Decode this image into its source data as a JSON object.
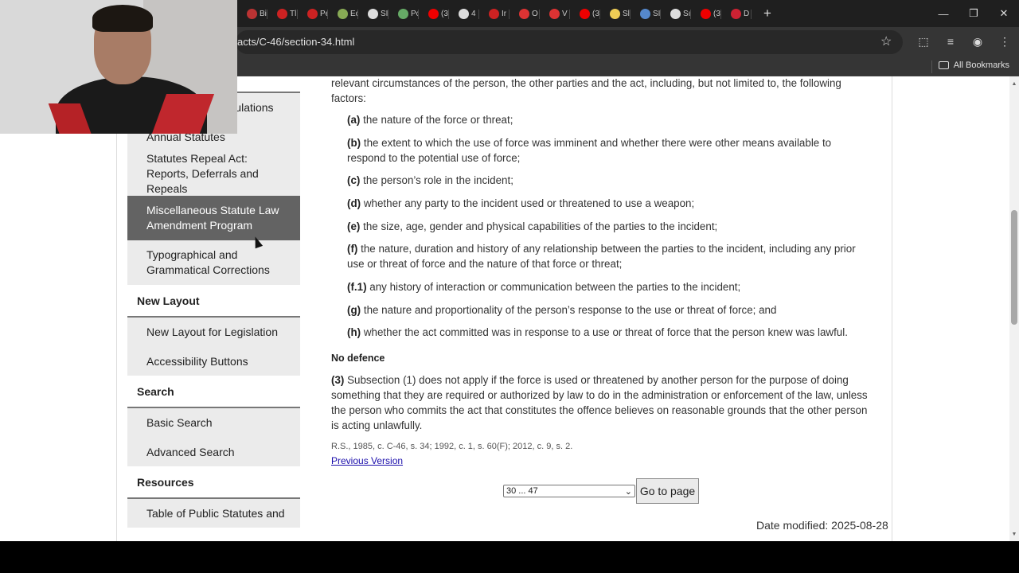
{
  "browser": {
    "tabs": [
      {
        "label": "Bi",
        "color": "#b33"
      },
      {
        "label": "Tl",
        "color": "#c22"
      },
      {
        "label": "Pe",
        "color": "#c22"
      },
      {
        "label": "Ec",
        "color": "#8a5"
      },
      {
        "label": "SI",
        "color": "#ddd"
      },
      {
        "label": "Pc",
        "color": "#6a6"
      },
      {
        "label": "(3",
        "color": "#e00"
      },
      {
        "label": "4",
        "color": "#ddd"
      },
      {
        "label": "Ir",
        "color": "#c22"
      },
      {
        "label": "O",
        "color": "#d33"
      },
      {
        "label": "V",
        "color": "#d33"
      },
      {
        "label": "(3",
        "color": "#e00"
      },
      {
        "label": "Sl",
        "color": "#ec5"
      },
      {
        "label": "SI",
        "color": "#58c"
      },
      {
        "label": "Sı",
        "color": "#ddd"
      },
      {
        "label": "(3",
        "color": "#e00"
      },
      {
        "label": "D",
        "color": "#c23"
      }
    ],
    "url": "acts/C-46/section-34.html",
    "all_bookmarks": "All Bookmarks"
  },
  "sidebar": {
    "items": [
      {
        "label": "Consolidated Regulations",
        "type": "item"
      },
      {
        "label": "Annual Statutes",
        "type": "item"
      },
      {
        "label": "Statutes Repeal Act: Reports, Deferrals and Repeals",
        "type": "item"
      },
      {
        "label": "Miscellaneous Statute Law Amendment Program",
        "type": "item",
        "active": true
      },
      {
        "label": "Typographical and Grammatical Corrections",
        "type": "item"
      },
      {
        "label": "New Layout",
        "type": "heading"
      },
      {
        "label": "New Layout for Legislation",
        "type": "item"
      },
      {
        "label": "Accessibility Buttons",
        "type": "item"
      },
      {
        "label": "Search",
        "type": "heading"
      },
      {
        "label": "Basic Search",
        "type": "item"
      },
      {
        "label": "Advanced Search",
        "type": "item"
      },
      {
        "label": "Resources",
        "type": "heading"
      },
      {
        "label": "Table of Public Statutes and",
        "type": "item"
      }
    ]
  },
  "content": {
    "intro": "relevant circumstances of the person, the other parties and the act, including, but not limited to, the following factors:",
    "factors": [
      {
        "marker": "(a)",
        "text": "the nature of the force or threat;"
      },
      {
        "marker": "(b)",
        "text": "the extent to which the use of force was imminent and whether there were other means available to respond to the potential use of force;"
      },
      {
        "marker": "(c)",
        "text": "the person’s role in the incident;"
      },
      {
        "marker": "(d)",
        "text": "whether any party to the incident used or threatened to use a weapon;"
      },
      {
        "marker": "(e)",
        "text": "the size, age, gender and physical capabilities of the parties to the incident;"
      },
      {
        "marker": "(f)",
        "text": "the nature, duration and history of any relationship between the parties to the incident, including any prior use or threat of force and the nature of that force or threat;"
      },
      {
        "marker": "(f.1)",
        "text": "any history of interaction or communication between the parties to the incident;"
      },
      {
        "marker": "(g)",
        "text": "the nature and proportionality of the person’s response to the use or threat of force; and"
      },
      {
        "marker": "(h)",
        "text": "whether the act committed was in response to a use or threat of force that the person knew was lawful."
      }
    ],
    "subheading": "No defence",
    "sub3_marker": "(3)",
    "sub3_text": "Subsection (1) does not apply if the force is used or threatened by another person for the purpose of doing something that they are required or authorized by law to do in the administration or enforcement of the law, unless the person who commits the act that constitutes the offence believes on reasonable grounds that the other person is acting unlawfully.",
    "history": "R.S., 1985, c. C-46, s. 34;   1992, c. 1, s. 60(F);   2012, c. 9, s. 2.",
    "previous_version": "Previous Version",
    "pager_select": "30 ... 47",
    "goto_label": "Go to page",
    "date_modified": "Date modified: 2025-08-28"
  }
}
